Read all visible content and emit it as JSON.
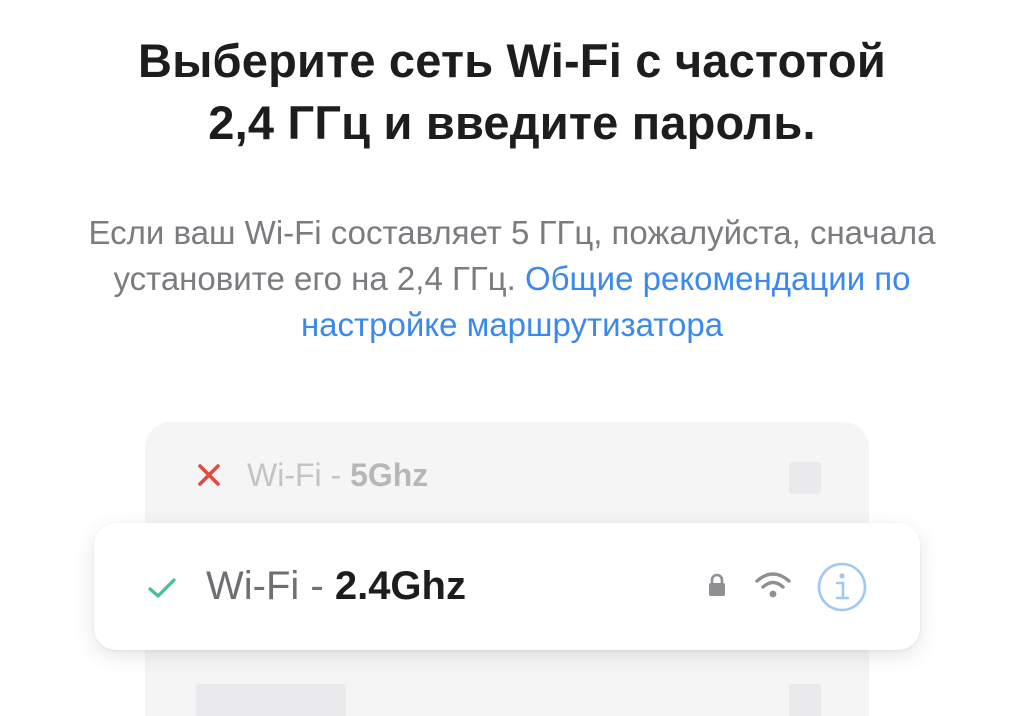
{
  "header": {
    "title_line1": "Выберите сеть Wi-Fi с частотой",
    "title_line2": "2,4 ГГц и введите пароль."
  },
  "notice": {
    "text": "Если ваш Wi-Fi составляет 5 ГГц, пожалуйста, сначала установите его на 2,4 ГГц. ",
    "link_text": "Общие рекомендации по настройке маршрутизатора"
  },
  "networks": {
    "invalid": {
      "prefix": "Wi-Fi - ",
      "band": "5Ghz",
      "status_icon": "cross-icon"
    },
    "valid": {
      "prefix": "Wi-Fi - ",
      "band": "2.4Ghz",
      "status_icon": "check-icon",
      "icons": [
        "lock-icon",
        "wifi-icon",
        "info-icon"
      ]
    }
  },
  "colors": {
    "title": "#1d1d1f",
    "body": "#7b7b80",
    "link": "#3b89ec",
    "cross": "#e5483f",
    "check": "#3fc48e",
    "info": "#9fc8f3"
  }
}
